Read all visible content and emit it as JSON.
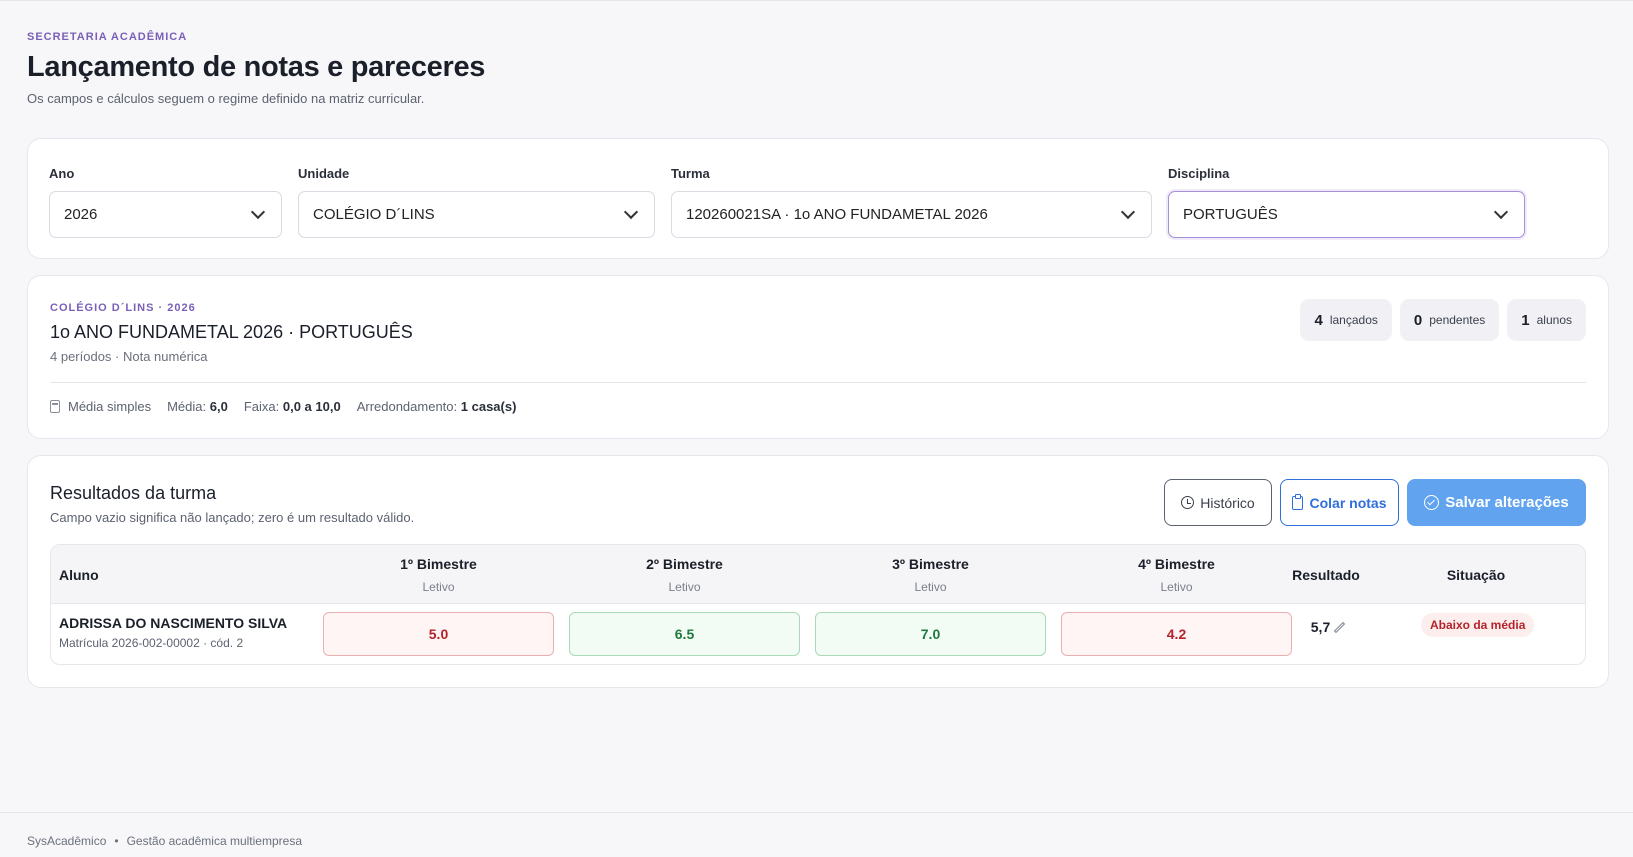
{
  "header": {
    "eyebrow": "SECRETARIA ACADÊMICA",
    "title": "Lançamento de notas e pareceres",
    "subtitle": "Os campos e cálculos seguem o regime definido na matriz curricular."
  },
  "filters": {
    "ano": {
      "label": "Ano",
      "value": "2026"
    },
    "unidade": {
      "label": "Unidade",
      "value": "COLÉGIO D´LINS"
    },
    "turma": {
      "label": "Turma",
      "value": "120260021SA · 1o ANO FUNDAMETAL 2026"
    },
    "disciplina": {
      "label": "Disciplina",
      "value": "PORTUGUÊS"
    }
  },
  "summary": {
    "eyebrow": "COLÉGIO D´LINS · 2026",
    "title": "1o ANO FUNDAMETAL 2026 · PORTUGUÊS",
    "subtitle": "4 períodos · Nota numérica",
    "stats": [
      {
        "num": "4",
        "label": "lançados"
      },
      {
        "num": "0",
        "label": "pendentes"
      },
      {
        "num": "1",
        "label": "alunos"
      }
    ],
    "meta": {
      "method": "Média simples",
      "media_label": "Média:",
      "media_value": "6,0",
      "faixa_label": "Faixa:",
      "faixa_value": "0,0 a 10,0",
      "arred_label": "Arredondamento:",
      "arred_value": "1 casa(s)"
    }
  },
  "results": {
    "title": "Resultados da turma",
    "subtitle": "Campo vazio significa não lançado; zero é um resultado válido.",
    "buttons": {
      "historico": "Histórico",
      "colar": "Colar notas",
      "salvar": "Salvar alterações"
    },
    "columns": {
      "aluno": "Aluno",
      "b1": "1º Bimestre",
      "b2": "2º Bimestre",
      "b3": "3º Bimestre",
      "b4": "4º Bimestre",
      "period_type": "Letivo",
      "resultado": "Resultado",
      "situacao": "Situação"
    },
    "rows": [
      {
        "name": "ADRISSA DO NASCIMENTO SILVA",
        "meta": "Matrícula 2026-002-00002 · cód. 2",
        "grades": [
          "5.0",
          "6.5",
          "7.0",
          "4.2"
        ],
        "result": "5,7",
        "status": "Abaixo da média"
      }
    ]
  },
  "footer": {
    "app": "SysAcadêmico",
    "separator": "•",
    "tagline": "Gestão acadêmica multiempresa"
  },
  "colors": {
    "accent": "#7a5fb8",
    "primary": "#62a3ef",
    "link": "#2f6fdc",
    "danger": "#b3232a",
    "success": "#1e7a3c"
  }
}
